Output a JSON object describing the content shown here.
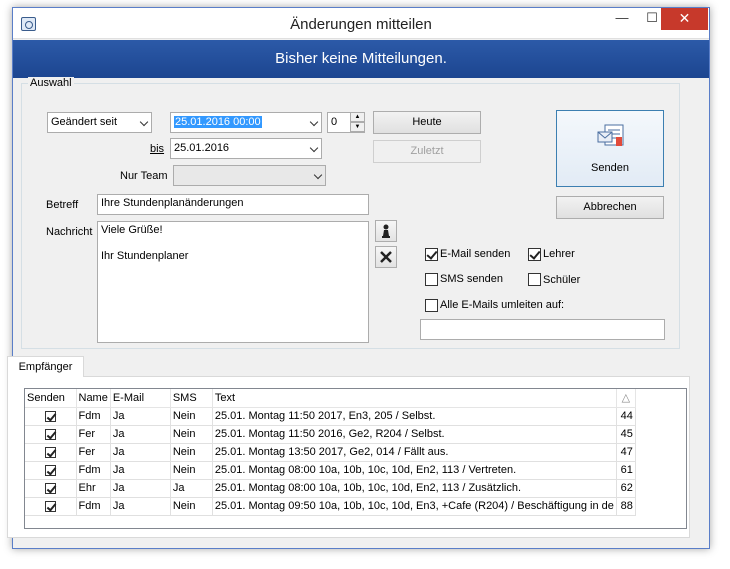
{
  "window": {
    "title": "Änderungen mitteilen",
    "banner": "Bisher keine Mitteilungen.",
    "min_glyph": "—",
    "max_glyph": "☐",
    "close_glyph": "✕"
  },
  "auswahl": {
    "legend": "Auswahl",
    "changed_since_mode": "Geändert seit",
    "from_datetime": "25.01.2016 00:00",
    "days_value": "0",
    "bis_label": "bis",
    "to_date": "25.01.2016",
    "team_label": "Nur Team",
    "team_value": "",
    "heute_button": "Heute",
    "zuletzt_button": "Zuletzt",
    "betreff_label": "Betreff",
    "betreff_value": "Ihre Stundenplanänderungen",
    "nachricht_label": "Nachricht",
    "nachricht_line1": "Viele Grüße!",
    "nachricht_line2": "Ihr Stundenplaner",
    "email_senden": "E-Mail senden",
    "email_senden_checked": true,
    "sms_senden": "SMS senden",
    "sms_senden_checked": false,
    "lehrer": "Lehrer",
    "lehrer_checked": true,
    "schueler": "Schüler",
    "schueler_checked": false,
    "umleiten": "Alle E-Mails umleiten auf:",
    "umleiten_checked": false,
    "umleiten_value": "",
    "senden_button": "Senden",
    "abbrechen_button": "Abbrechen",
    "icons": {
      "placeholder": "chess-pawn-icon",
      "delete": "x-icon",
      "send": "envelope-send-icon"
    }
  },
  "tab": {
    "label": "Empfänger"
  },
  "grid": {
    "columns": [
      "Senden",
      "Name",
      "E-Mail",
      "SMS",
      "Text",
      "△"
    ],
    "rows": [
      {
        "senden": true,
        "name": "Fdm",
        "email": "Ja",
        "sms": "Nein",
        "text": "25.01. Montag 11:50 2017, En3, 205 / Selbst.",
        "nr": "44"
      },
      {
        "senden": true,
        "name": "Fer",
        "email": "Ja",
        "sms": "Nein",
        "text": "25.01. Montag 11:50 2016, Ge2, R204 / Selbst.",
        "nr": "45"
      },
      {
        "senden": true,
        "name": "Fer",
        "email": "Ja",
        "sms": "Nein",
        "text": "25.01. Montag 13:50 2017, Ge2, 014 / Fällt aus.",
        "nr": "47"
      },
      {
        "senden": true,
        "name": "Fdm",
        "email": "Ja",
        "sms": "Nein",
        "text": "25.01. Montag 08:00 10a, 10b, 10c, 10d, En2, 113 / Vertreten.",
        "nr": "61"
      },
      {
        "senden": true,
        "name": "Ehr",
        "email": "Ja",
        "sms": "Ja",
        "text": "25.01. Montag 08:00 10a, 10b, 10c, 10d, En2, 113 / Zusätzlich.",
        "nr": "62"
      },
      {
        "senden": true,
        "name": "Fdm",
        "email": "Ja",
        "sms": "Nein",
        "text": "25.01. Montag 09:50 10a, 10b, 10c, 10d, En3, +Cafe (R204) / Beschäftigung in de",
        "nr": "88"
      }
    ]
  }
}
